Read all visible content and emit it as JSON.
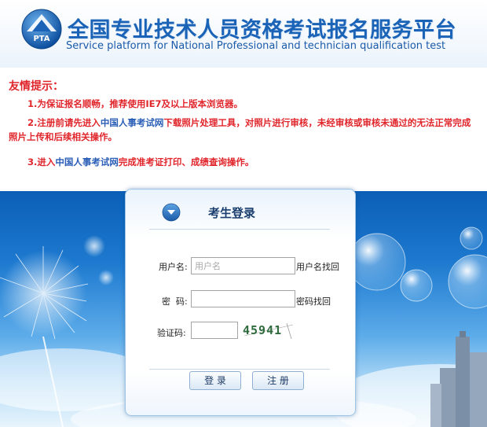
{
  "header": {
    "logo_text": "PTA",
    "title_zh": "全国专业技术人员资格考试报名服务平台",
    "title_en": "Service platform for National Professional and technician qualification test"
  },
  "notice": {
    "title": "友情提示：",
    "tip1": "1.为保证报名顺畅，推荐使用IE7及以上版本浏览器。",
    "tip2_pre": "2.注册前请先进入",
    "tip2_link": "中国人事考试网",
    "tip2_post": "下载照片处理工具，对照片进行审核，未经审核或审核未通过的无法正常完成照片上传和后续相关操作。",
    "tip3_pre": "3.进入",
    "tip3_link": "中国人事考试网",
    "tip3_post": "完成准考证打印、成绩查询操作。"
  },
  "login": {
    "title": "考生登录",
    "username_label": "用户名:",
    "username_placeholder": "用户名",
    "username_recover": "用户名找回",
    "password_label": "密  码:",
    "password_recover": "密码找回",
    "captcha_label": "验证码:",
    "captcha_value": "45941",
    "login_button": "登 录",
    "register_button": "注 册"
  },
  "colors": {
    "brand_blue": "#1a63b6",
    "notice_red": "#e0252b",
    "link_blue": "#2b5fb7"
  }
}
